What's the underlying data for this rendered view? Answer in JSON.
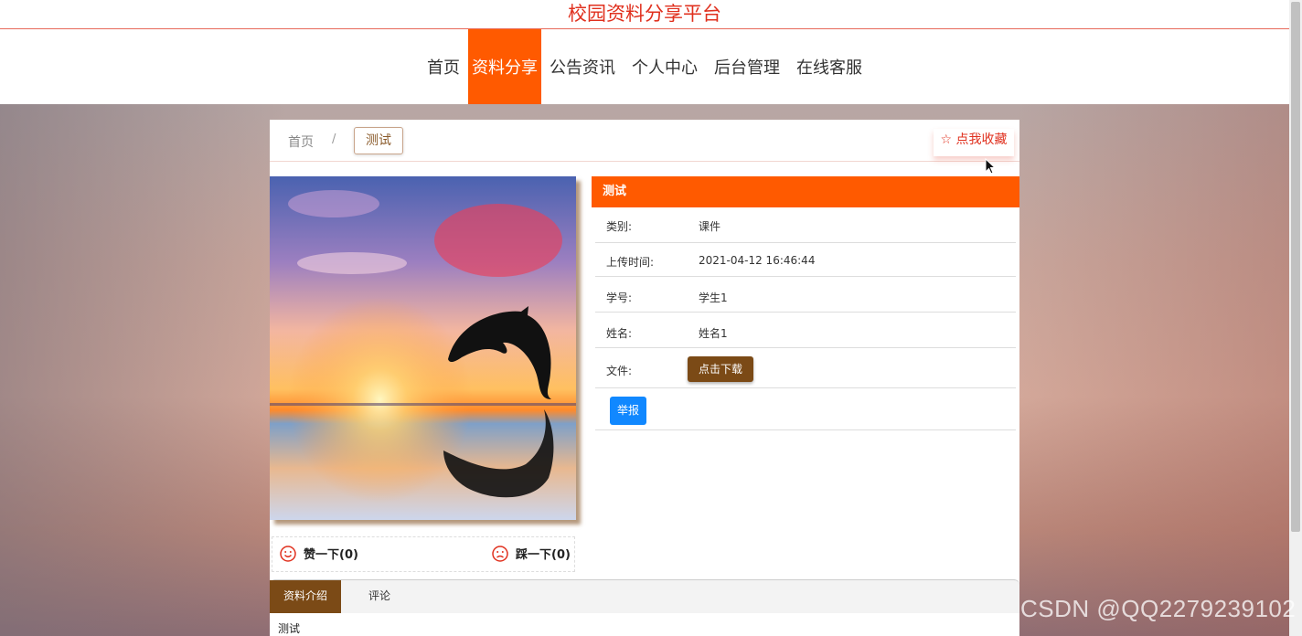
{
  "site": {
    "title": "校园资料分享平台"
  },
  "nav": {
    "items": [
      {
        "label": "首页",
        "active": false
      },
      {
        "label": "资料分享",
        "active": true
      },
      {
        "label": "公告资讯",
        "active": false
      },
      {
        "label": "个人中心",
        "active": false
      },
      {
        "label": "后台管理",
        "active": false
      },
      {
        "label": "在线客服",
        "active": false
      }
    ]
  },
  "breadcrumb": {
    "home": "首页",
    "separator": "/",
    "current": "测试"
  },
  "favorite": {
    "label": "☆ 点我收藏"
  },
  "votes": {
    "like_label": "赞一下(0)",
    "dislike_label": "踩一下(0)"
  },
  "detail": {
    "title": "测试",
    "rows": [
      {
        "label": "类别:",
        "value": "课件"
      },
      {
        "label": "上传时间:",
        "value": "2021-04-12 16:46:44"
      },
      {
        "label": "学号:",
        "value": "学生1"
      },
      {
        "label": "姓名:",
        "value": "姓名1"
      },
      {
        "label": "文件:",
        "value": ""
      }
    ],
    "download_label": "点击下载",
    "report_label": "举报"
  },
  "tabs": [
    {
      "label": "资料介绍",
      "active": true
    },
    {
      "label": "评论",
      "active": false
    }
  ],
  "description": "测试",
  "watermark": "CSDN @QQ2279239102",
  "colors": {
    "accent": "#ff5a00",
    "title": "#e0301e",
    "brown": "#7b4a16",
    "report": "#1188ff"
  }
}
